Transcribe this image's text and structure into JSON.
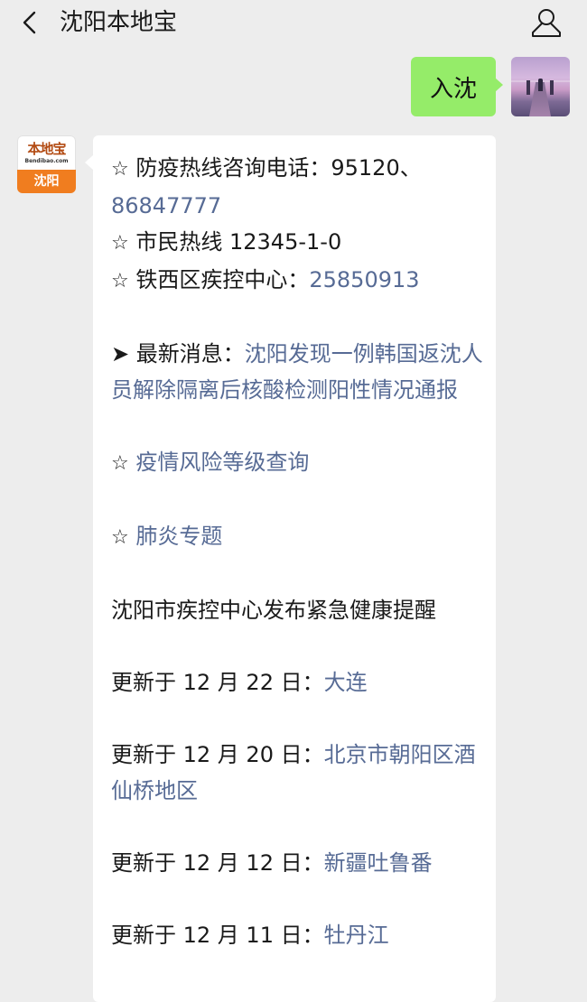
{
  "header": {
    "back_icon": "chevron-left-icon",
    "title": "沈阳本地宝",
    "profile_icon": "person-icon"
  },
  "outgoing_message": {
    "text": "入沈",
    "bubble_color": "#95ec69"
  },
  "bot": {
    "avatar": {
      "logo_text": "本地宝",
      "logo_url": "Bendibao.com",
      "city": "沈阳",
      "accent_color": "#f07d1f"
    },
    "message": {
      "hotline": {
        "bullet": "☆",
        "label": "防疫热线咨询电话：95120、",
        "number": "86847777"
      },
      "citizen_hotline": {
        "bullet": "☆",
        "label": "市民热线 12345-1-0"
      },
      "tiexi_cdc": {
        "bullet": "☆",
        "label": "铁西区疾控中心：",
        "number": "25850913"
      },
      "latest_news": {
        "bullet": "➤",
        "label": "最新消息：",
        "link": "沈阳发现一例韩国返沈人员解除隔离后核酸检测阳性情况通报"
      },
      "risk_query": {
        "bullet": "☆",
        "link": "疫情风险等级查询"
      },
      "pneumonia_topic": {
        "bullet": "☆",
        "link": "肺炎专题"
      },
      "health_alert": "沈阳市疾控中心发布紧急健康提醒",
      "updates": [
        {
          "label": "更新于 12 月 22 日：",
          "link": "大连"
        },
        {
          "label": "更新于 12 月 20 日：",
          "link": "北京市朝阳区酒仙桥地区"
        },
        {
          "label": "更新于 12 月 12 日：",
          "link": "新疆吐鲁番"
        },
        {
          "label": "更新于 12 月 11 日：",
          "link": "牡丹江"
        }
      ],
      "link_color": "#576b95"
    }
  }
}
